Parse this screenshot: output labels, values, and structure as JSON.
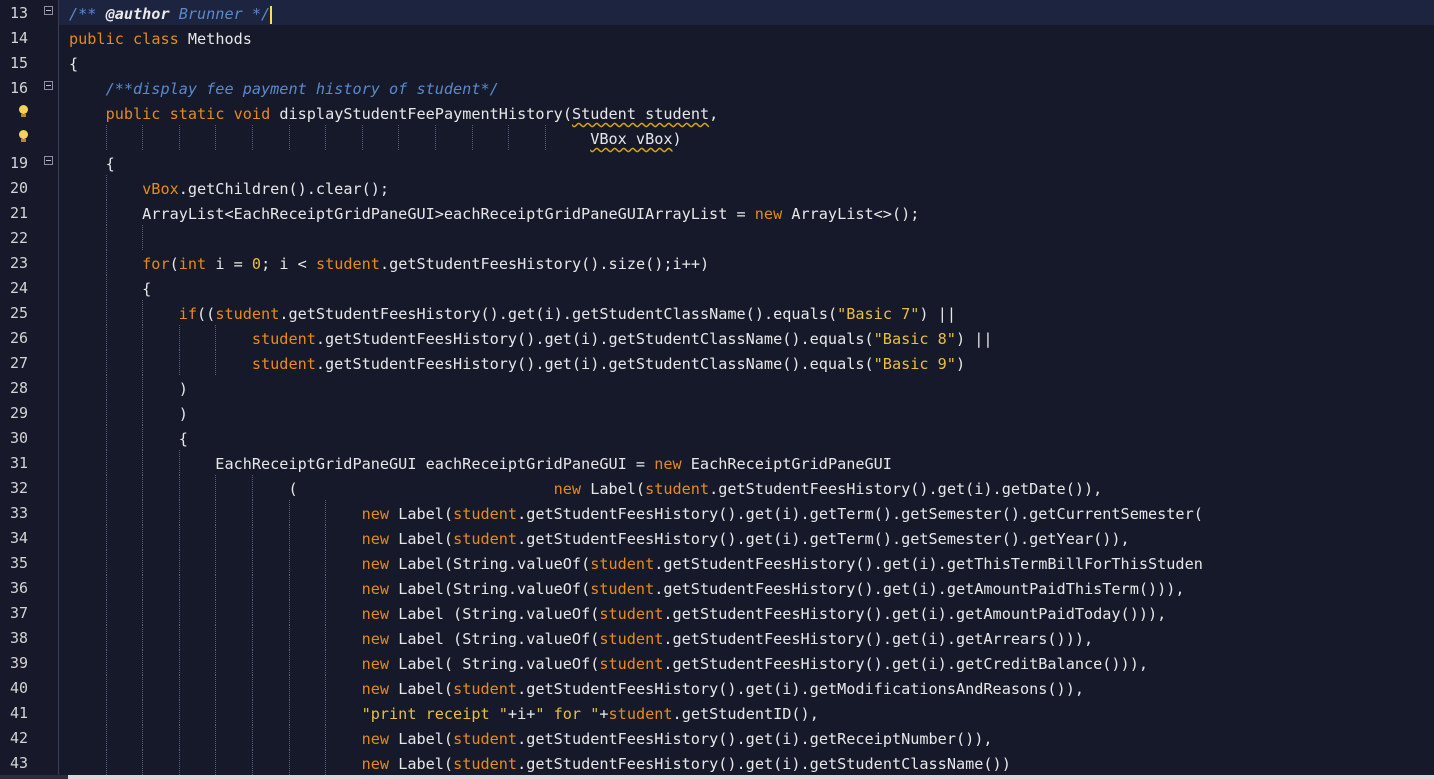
{
  "editor": {
    "colors": {
      "background": "#15192a",
      "keyword": "#e58a1a",
      "comment": "#5b89c9",
      "string": "#e9bf3d",
      "field": "#ea8c14",
      "plain": "#e7e7e7"
    },
    "lines": [
      {
        "n": "13",
        "fold": true,
        "current": true,
        "tokens": [
          [
            "com",
            "/** "
          ],
          [
            "tag",
            "@author"
          ],
          [
            "com",
            " Brunner */"
          ],
          [
            "caret",
            ""
          ]
        ]
      },
      {
        "n": "14",
        "tokens": [
          [
            "kw",
            "public"
          ],
          [
            "p",
            " "
          ],
          [
            "kw",
            "class"
          ],
          [
            "p",
            " Methods"
          ]
        ]
      },
      {
        "n": "15",
        "tokens": [
          [
            "p",
            "{"
          ]
        ]
      },
      {
        "n": "16",
        "fold": true,
        "tokens": [
          [
            "p",
            "    "
          ],
          [
            "com",
            "/**display fee payment history of student*/"
          ]
        ]
      },
      {
        "n": "",
        "hint": true,
        "tokens": [
          [
            "p",
            "    "
          ],
          [
            "kw",
            "public"
          ],
          [
            "p",
            " "
          ],
          [
            "kw",
            "static"
          ],
          [
            "p",
            " "
          ],
          [
            "kw",
            "void"
          ],
          [
            "p",
            " displayStudentFeePaymentHistory("
          ],
          [
            "err",
            "Student student"
          ],
          [
            "p",
            ","
          ]
        ]
      },
      {
        "n": "",
        "hint": true,
        "tokens": [
          [
            "p",
            "                                                         "
          ],
          [
            "err",
            "VBox vBox"
          ],
          [
            "p",
            ")"
          ]
        ]
      },
      {
        "n": "19",
        "fold": true,
        "tokens": [
          [
            "p",
            "    {"
          ]
        ]
      },
      {
        "n": "20",
        "tokens": [
          [
            "p",
            "        "
          ],
          [
            "fld",
            "vBox"
          ],
          [
            "p",
            ".getChildren().clear();"
          ]
        ]
      },
      {
        "n": "21",
        "tokens": [
          [
            "p",
            "        ArrayList<EachReceiptGridPaneGUI>eachReceiptGridPaneGUIArrayList = "
          ],
          [
            "kw",
            "new"
          ],
          [
            "p",
            " ArrayList<>();"
          ]
        ]
      },
      {
        "n": "22",
        "tokens": []
      },
      {
        "n": "23",
        "tokens": [
          [
            "p",
            "        "
          ],
          [
            "kw",
            "for"
          ],
          [
            "p",
            "("
          ],
          [
            "kw",
            "int"
          ],
          [
            "p",
            " i = "
          ],
          [
            "num",
            "0"
          ],
          [
            "p",
            "; i < "
          ],
          [
            "fld",
            "student"
          ],
          [
            "p",
            ".getStudentFeesHistory().size();i++)"
          ]
        ]
      },
      {
        "n": "24",
        "tokens": [
          [
            "p",
            "        {"
          ]
        ]
      },
      {
        "n": "25",
        "tokens": [
          [
            "p",
            "            "
          ],
          [
            "kw",
            "if"
          ],
          [
            "p",
            "(("
          ],
          [
            "fld",
            "student"
          ],
          [
            "p",
            ".getStudentFeesHistory().get(i).getStudentClassName().equals("
          ],
          [
            "str",
            "\"Basic 7\""
          ],
          [
            "p",
            ") ||"
          ]
        ]
      },
      {
        "n": "26",
        "tokens": [
          [
            "p",
            "                    "
          ],
          [
            "fld",
            "student"
          ],
          [
            "p",
            ".getStudentFeesHistory().get(i).getStudentClassName().equals("
          ],
          [
            "str",
            "\"Basic 8\""
          ],
          [
            "p",
            ") ||"
          ]
        ]
      },
      {
        "n": "27",
        "tokens": [
          [
            "p",
            "                    "
          ],
          [
            "fld",
            "student"
          ],
          [
            "p",
            ".getStudentFeesHistory().get(i).getStudentClassName().equals("
          ],
          [
            "str",
            "\"Basic 9\""
          ],
          [
            "p",
            ")"
          ]
        ]
      },
      {
        "n": "28",
        "tokens": [
          [
            "p",
            "            )"
          ]
        ]
      },
      {
        "n": "29",
        "tokens": [
          [
            "p",
            "            )"
          ]
        ]
      },
      {
        "n": "30",
        "tokens": [
          [
            "p",
            "            {"
          ]
        ]
      },
      {
        "n": "31",
        "tokens": [
          [
            "p",
            "                EachReceiptGridPaneGUI eachReceiptGridPaneGUI = "
          ],
          [
            "kw",
            "new"
          ],
          [
            "p",
            " EachReceiptGridPaneGUI"
          ]
        ]
      },
      {
        "n": "32",
        "tokens": [
          [
            "p",
            "                        (                            "
          ],
          [
            "kw",
            "new"
          ],
          [
            "p",
            " Label("
          ],
          [
            "fld",
            "student"
          ],
          [
            "p",
            ".getStudentFeesHistory().get(i).getDate()),"
          ]
        ]
      },
      {
        "n": "33",
        "tokens": [
          [
            "p",
            "                                "
          ],
          [
            "kw",
            "new"
          ],
          [
            "p",
            " Label("
          ],
          [
            "fld",
            "student"
          ],
          [
            "p",
            ".getStudentFeesHistory().get(i).getTerm().getSemester().getCurrentSemester("
          ]
        ]
      },
      {
        "n": "34",
        "tokens": [
          [
            "p",
            "                                "
          ],
          [
            "kw",
            "new"
          ],
          [
            "p",
            " Label("
          ],
          [
            "fld",
            "student"
          ],
          [
            "p",
            ".getStudentFeesHistory().get(i).getTerm().getSemester().getYear()),"
          ]
        ]
      },
      {
        "n": "35",
        "tokens": [
          [
            "p",
            "                                "
          ],
          [
            "kw",
            "new"
          ],
          [
            "p",
            " Label(String.valueOf("
          ],
          [
            "fld",
            "student"
          ],
          [
            "p",
            ".getStudentFeesHistory().get(i).getThisTermBillForThisStuden"
          ]
        ]
      },
      {
        "n": "36",
        "tokens": [
          [
            "p",
            "                                "
          ],
          [
            "kw",
            "new"
          ],
          [
            "p",
            " Label(String.valueOf("
          ],
          [
            "fld",
            "student"
          ],
          [
            "p",
            ".getStudentFeesHistory().get(i).getAmountPaidThisTerm())),"
          ]
        ]
      },
      {
        "n": "37",
        "tokens": [
          [
            "p",
            "                                "
          ],
          [
            "kw",
            "new"
          ],
          [
            "p",
            " Label (String.valueOf("
          ],
          [
            "fld",
            "student"
          ],
          [
            "p",
            ".getStudentFeesHistory().get(i).getAmountPaidToday())),"
          ]
        ]
      },
      {
        "n": "38",
        "tokens": [
          [
            "p",
            "                                "
          ],
          [
            "kw",
            "new"
          ],
          [
            "p",
            " Label (String.valueOf("
          ],
          [
            "fld",
            "student"
          ],
          [
            "p",
            ".getStudentFeesHistory().get(i).getArrears())),"
          ]
        ]
      },
      {
        "n": "39",
        "tokens": [
          [
            "p",
            "                                "
          ],
          [
            "kw",
            "new"
          ],
          [
            "p",
            " Label( String.valueOf("
          ],
          [
            "fld",
            "student"
          ],
          [
            "p",
            ".getStudentFeesHistory().get(i).getCreditBalance())),"
          ]
        ]
      },
      {
        "n": "40",
        "tokens": [
          [
            "p",
            "                                "
          ],
          [
            "kw",
            "new"
          ],
          [
            "p",
            " Label("
          ],
          [
            "fld",
            "student"
          ],
          [
            "p",
            ".getStudentFeesHistory().get(i).getModificationsAndReasons()),"
          ]
        ]
      },
      {
        "n": "41",
        "tokens": [
          [
            "p",
            "                                "
          ],
          [
            "str",
            "\"print receipt \""
          ],
          [
            "p",
            "+i+"
          ],
          [
            "str",
            "\" for \""
          ],
          [
            "p",
            "+"
          ],
          [
            "fld",
            "student"
          ],
          [
            "p",
            ".getStudentID(),"
          ]
        ]
      },
      {
        "n": "42",
        "tokens": [
          [
            "p",
            "                                "
          ],
          [
            "kw",
            "new"
          ],
          [
            "p",
            " Label("
          ],
          [
            "fld",
            "student"
          ],
          [
            "p",
            ".getStudentFeesHistory().get(i).getReceiptNumber()),"
          ]
        ]
      },
      {
        "n": "43",
        "tokens": [
          [
            "p",
            "                                "
          ],
          [
            "kw",
            "new"
          ],
          [
            "p",
            " Label("
          ],
          [
            "fld",
            "student"
          ],
          [
            "p",
            ".getStudentFeesHistory().get(i).getStudentClassName())"
          ]
        ]
      }
    ]
  }
}
